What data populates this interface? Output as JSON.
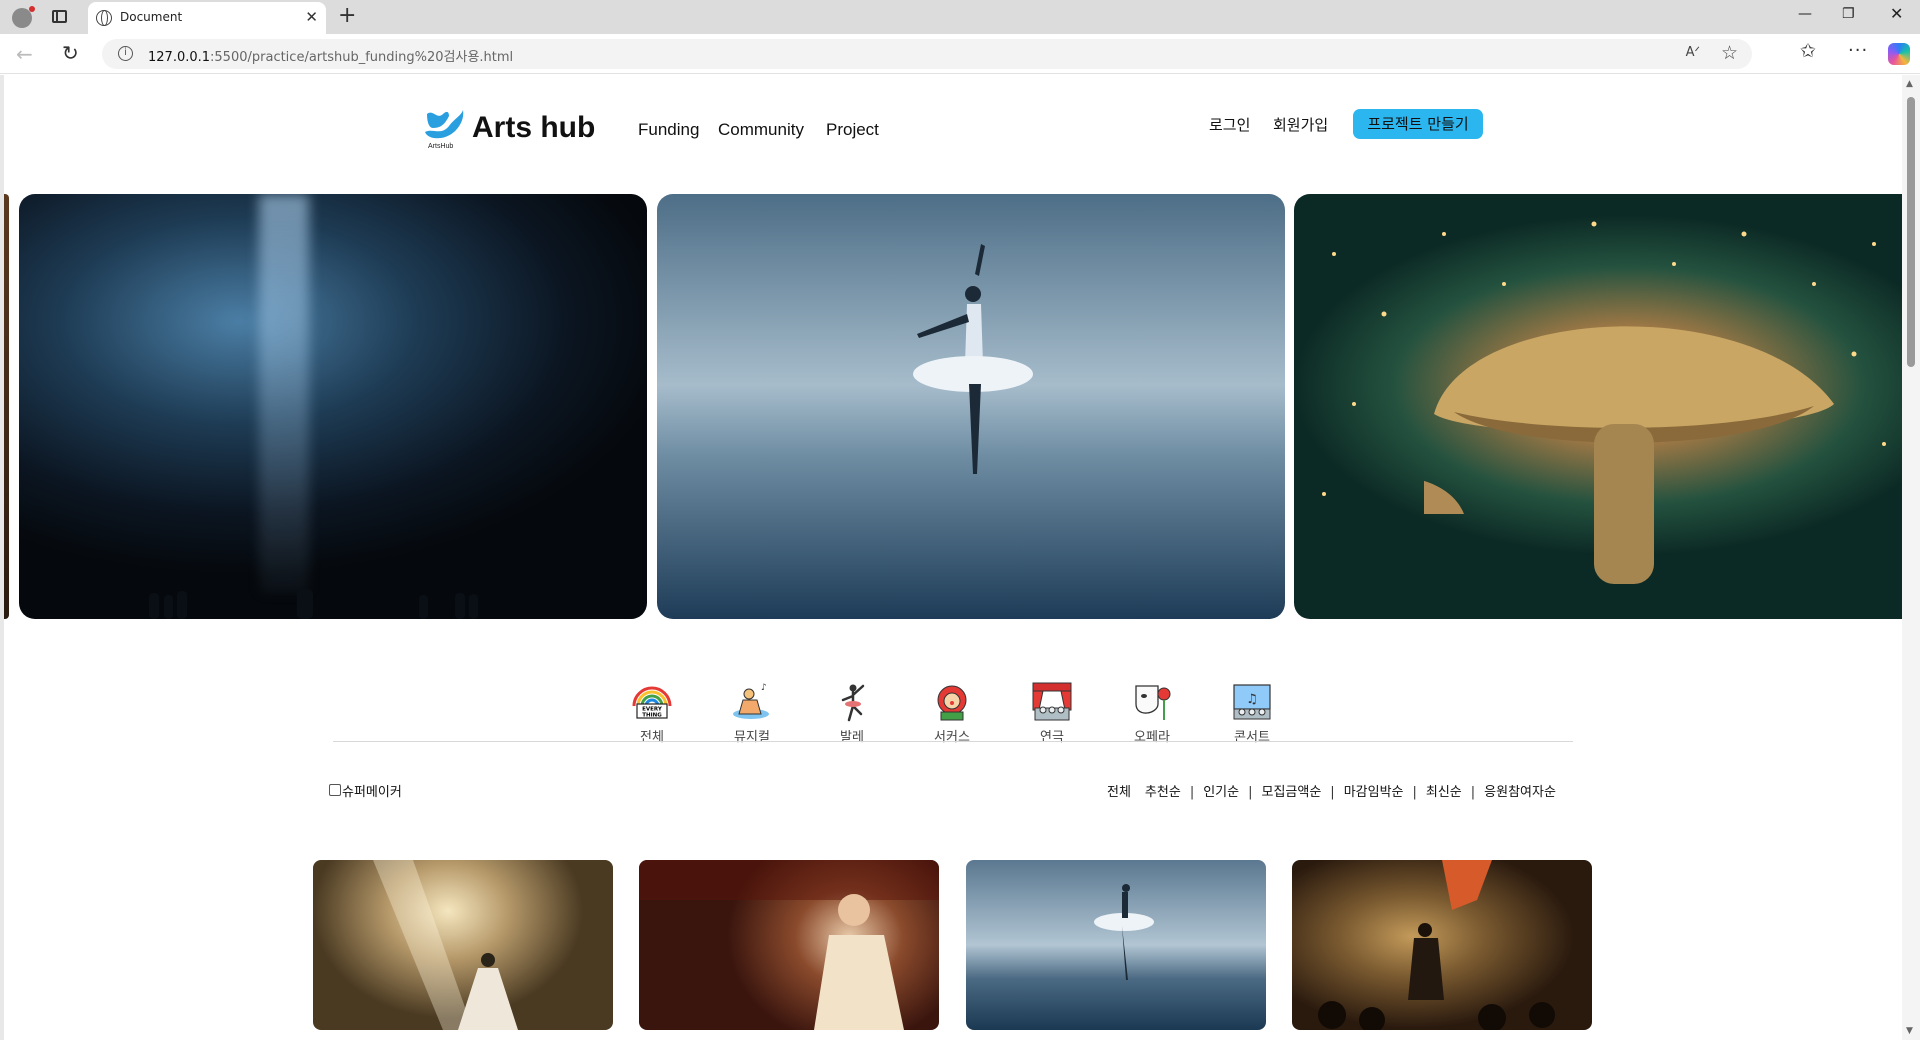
{
  "browser": {
    "tab_title": "Document",
    "url_host": "127.0.0.1",
    "url_rest": ":5500/practice/artshub_funding%20검사용.html"
  },
  "header": {
    "logo_sub": "ArtsHub",
    "brand": "Arts hub",
    "nav": [
      "Funding",
      "Community",
      "Project"
    ],
    "login": "로그인",
    "signup": "회원가입",
    "create_project": "프로젝트 만들기"
  },
  "categories": [
    {
      "label": "전체",
      "icon": "rainbow-everything-icon"
    },
    {
      "label": "뮤지컬",
      "icon": "musical-icon"
    },
    {
      "label": "발레",
      "icon": "ballet-icon"
    },
    {
      "label": "서커스",
      "icon": "circus-icon"
    },
    {
      "label": "연극",
      "icon": "theater-icon"
    },
    {
      "label": "오페라",
      "icon": "opera-mask-icon"
    },
    {
      "label": "콘서트",
      "icon": "concert-icon"
    }
  ],
  "filter": {
    "super_maker_label": "슈퍼메이커",
    "super_maker_checked": false,
    "sort_options": [
      "전체",
      "추천순",
      "인기순",
      "모집금액순",
      "마감임박순",
      "최신순",
      "응원참여자순"
    ]
  },
  "colors": {
    "accent": "#2bb6ef",
    "logo": "#2a9fe0"
  }
}
